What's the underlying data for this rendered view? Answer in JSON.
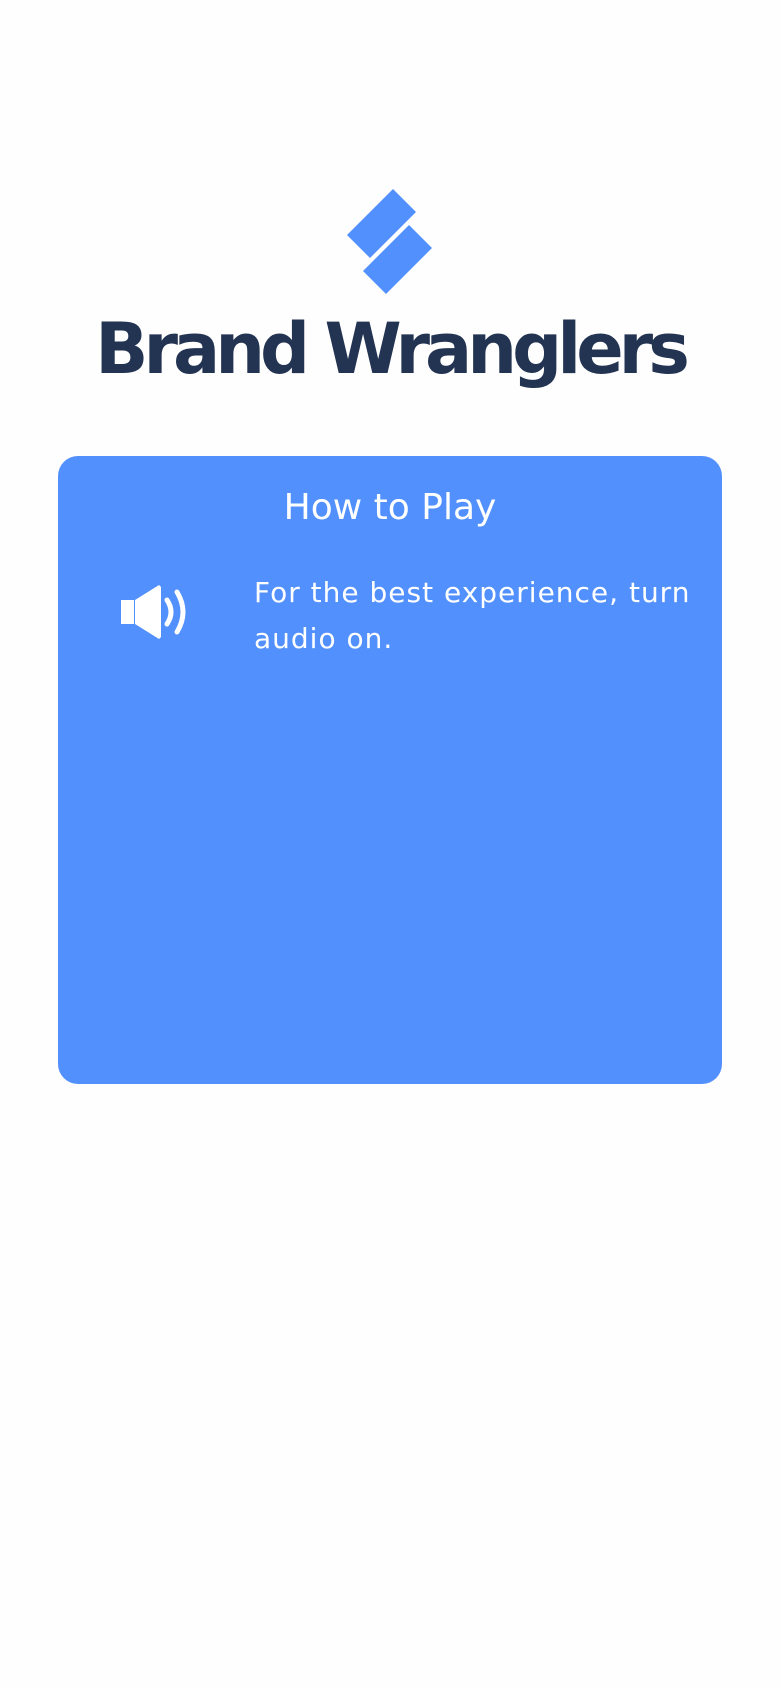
{
  "brand": {
    "logo_icon": "brand-logo-icon",
    "name": "Brand Wranglers"
  },
  "how_to_play": {
    "title": "How to Play",
    "audio_icon": "speaker-volume-icon",
    "audio_message": "For the best experience, turn audio on."
  },
  "colors": {
    "page_background": "#fefefe",
    "brand_navy": "#233352",
    "accent_blue": "#5290fe",
    "card_text": "#ffffff"
  }
}
